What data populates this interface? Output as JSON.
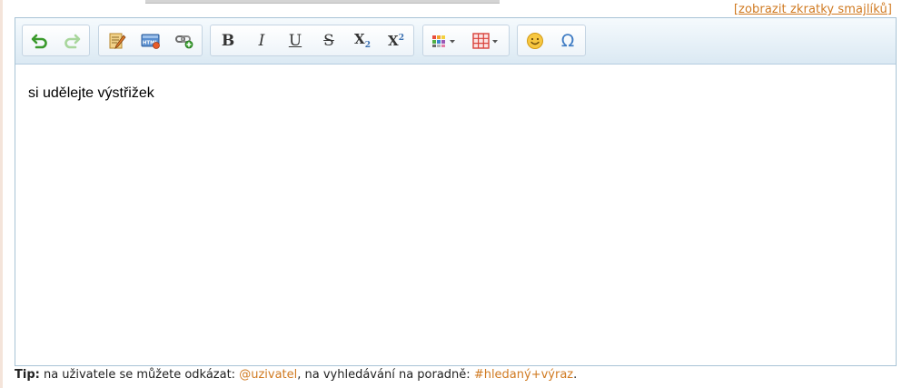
{
  "header": {
    "smiley_link": "[zobrazit zkratky smajlíků]"
  },
  "toolbar": {
    "groups": [
      {
        "buttons": [
          "undo-icon",
          "redo-icon"
        ]
      },
      {
        "buttons": [
          "spellcheck-icon",
          "html-source-icon",
          "insert-link-icon"
        ]
      },
      {
        "buttons": [
          "bold-icon",
          "italic-icon",
          "underline-icon",
          "strikethrough-icon",
          "subscript-icon",
          "superscript-icon"
        ]
      },
      {
        "buttons": [
          "text-color-icon",
          "table-icon"
        ]
      },
      {
        "buttons": [
          "emoticon-icon",
          "special-char-icon"
        ]
      }
    ],
    "labels": {
      "bold": "B",
      "italic": "I",
      "underline": "U",
      "strike": "S",
      "sub_base": "X",
      "sub_index": "2",
      "sup_base": "X",
      "sup_index": "2",
      "omega": "Ω"
    }
  },
  "editor": {
    "content": "si udělejte výstřižek"
  },
  "tip": {
    "label": "Tip:",
    "text1": " na uživatele se můžete odkázat: ",
    "mention": "@uzivatel",
    "text2": ", na vyhledávání na poradně: ",
    "hashtag": "#hledaný+výraz",
    "text3": "."
  },
  "colors": {
    "accent": "#d07a21",
    "toolbar_border": "#a9c4d6"
  }
}
